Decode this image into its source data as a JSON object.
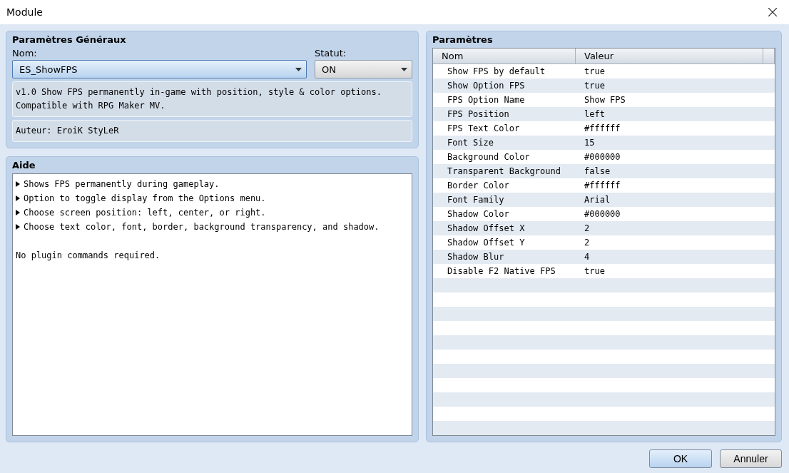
{
  "window": {
    "title": "Module"
  },
  "general": {
    "title": "Paramètres Généraux",
    "name_label": "Nom:",
    "name_value": "ES_ShowFPS",
    "status_label": "Statut:",
    "status_value": "ON",
    "description": [
      "v1.0 Show FPS permanently in-game with position, style & color options.",
      "Compatible with RPG Maker MV."
    ],
    "author": "Auteur: EroiK StyLeR"
  },
  "help": {
    "title": "Aide",
    "lines": [
      {
        "kind": "bullet",
        "text": "Shows FPS permanently during gameplay."
      },
      {
        "kind": "bullet",
        "text": "Option to toggle display from the Options menu."
      },
      {
        "kind": "bullet",
        "text": "Choose screen position: left, center, or right."
      },
      {
        "kind": "bullet",
        "text": "Choose text color, font, border, background transparency, and shadow."
      },
      {
        "kind": "blank"
      },
      {
        "kind": "plain",
        "text": "No plugin commands required."
      }
    ]
  },
  "parameters": {
    "title": "Paramètres",
    "columns": [
      "Nom",
      "Valeur"
    ],
    "rows": [
      {
        "name": "Show FPS by default",
        "value": "true"
      },
      {
        "name": "Show Option FPS",
        "value": "true"
      },
      {
        "name": "FPS Option Name",
        "value": "Show FPS"
      },
      {
        "name": "FPS Position",
        "value": "left"
      },
      {
        "name": "FPS Text Color",
        "value": "#ffffff"
      },
      {
        "name": "Font Size",
        "value": "15"
      },
      {
        "name": "Background Color",
        "value": "#000000"
      },
      {
        "name": "Transparent Background",
        "value": "false"
      },
      {
        "name": "Border Color",
        "value": "#ffffff"
      },
      {
        "name": "Font Family",
        "value": "Arial"
      },
      {
        "name": "Shadow Color",
        "value": "#000000"
      },
      {
        "name": "Shadow Offset X",
        "value": "2"
      },
      {
        "name": "Shadow Offset Y",
        "value": "2"
      },
      {
        "name": "Shadow Blur",
        "value": "4"
      },
      {
        "name": "Disable F2 Native FPS",
        "value": "true"
      }
    ]
  },
  "buttons": [
    {
      "label": "OK",
      "kind": "primary"
    },
    {
      "label": "Annuler",
      "kind": "secondary"
    }
  ]
}
